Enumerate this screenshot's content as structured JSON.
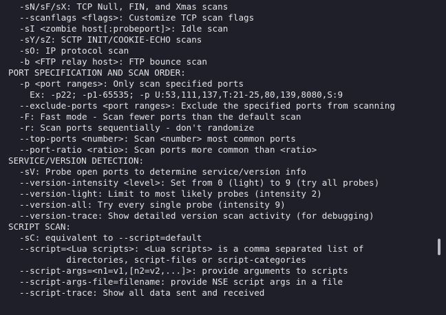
{
  "terminal": {
    "watermark": {
      "text": "",
      "subtitle": ""
    },
    "lines": [
      "-sN/sF/sX: TCP Null, FIN, and Xmas scans",
      "--scanflags <flags>: Customize TCP scan flags",
      "-sI <zombie host[:probeport]>: Idle scan",
      "-sY/sZ: SCTP INIT/COOKIE-ECHO scans",
      "-sO: IP protocol scan",
      "-b <FTP relay host>: FTP bounce scan",
      "PORT SPECIFICATION AND SCAN ORDER:",
      "-p <port ranges>: Only scan specified ports",
      "  Ex: -p22; -p1-65535; -p U:53,111,137,T:21-25,80,139,8080,S:9",
      "--exclude-ports <port ranges>: Exclude the specified ports from scanning",
      "-F: Fast mode - Scan fewer ports than the default scan",
      "-r: Scan ports sequentially - don't randomize",
      "--top-ports <number>: Scan <number> most common ports",
      "--port-ratio <ratio>: Scan ports more common than <ratio>",
      "SERVICE/VERSION DETECTION:",
      "-sV: Probe open ports to determine service/version info",
      "--version-intensity <level>: Set from 0 (light) to 9 (try all probes)",
      "--version-light: Limit to most likely probes (intensity 2)",
      "--version-all: Try every single probe (intensity 9)",
      "--version-trace: Show detailed version scan activity (for debugging)",
      "SCRIPT SCAN:",
      "-sC: equivalent to --script=default",
      "--script=<Lua scripts>: <Lua scripts> is a comma separated list of",
      "         directories, script-files or script-categories",
      "--script-args=<n1=v1,[n2=v2,...]>: provide arguments to scripts",
      "--script-args-file=filename: provide NSE script args in a file",
      "--script-trace: Show all data sent and received"
    ],
    "indents": [
      1,
      1,
      1,
      1,
      1,
      1,
      0,
      1,
      1,
      1,
      1,
      1,
      1,
      1,
      0,
      1,
      1,
      1,
      1,
      1,
      0,
      1,
      1,
      1,
      1,
      1,
      1
    ]
  }
}
